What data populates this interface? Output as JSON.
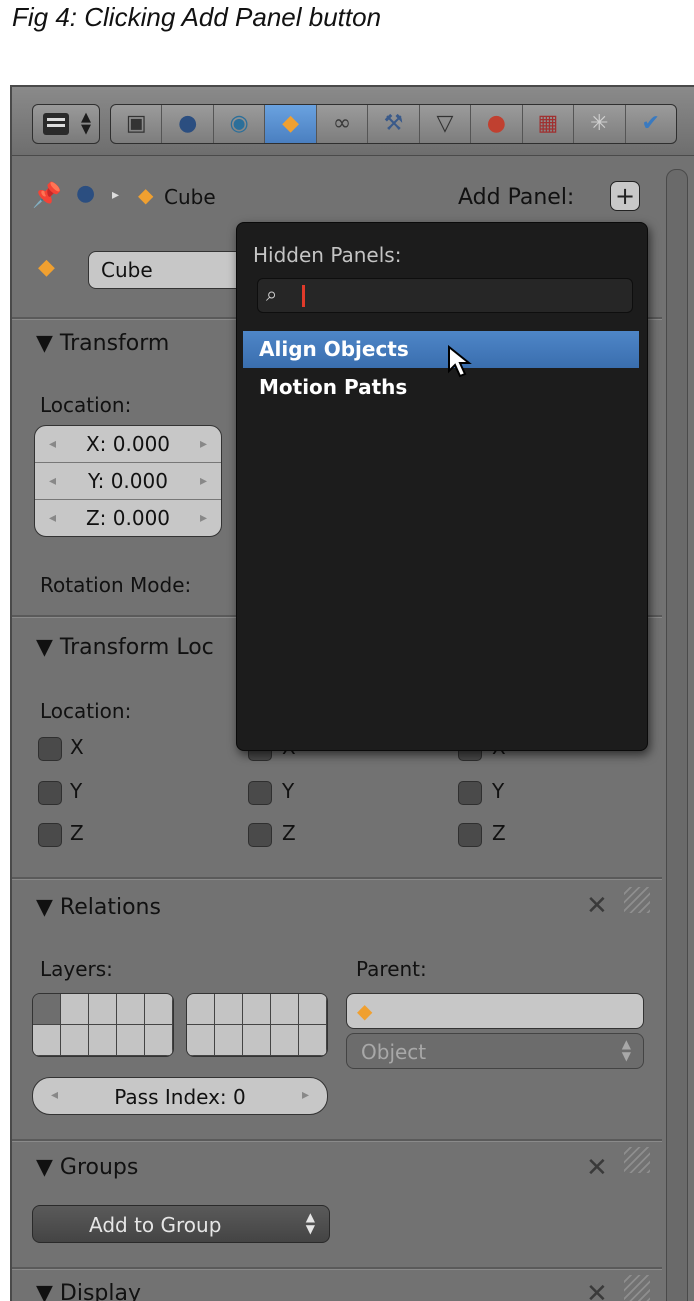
{
  "caption": "Fig 4: Clicking Add Panel button",
  "header": {
    "context_icons": [
      "camera-icon",
      "render-layers-icon",
      "world-icon",
      "object-icon",
      "constraints-icon",
      "wrench-icon",
      "mesh-data-icon",
      "material-icon",
      "texture-icon",
      "particles-icon",
      "physics-icon"
    ],
    "active_context": "object-icon"
  },
  "breadcrumb": {
    "object_name": "Cube",
    "add_panel_label": "Add Panel:"
  },
  "object_field": {
    "value": "Cube"
  },
  "transform": {
    "title": "Transform",
    "location_label": "Location:",
    "x": "X: 0.000",
    "y": "Y: 0.000",
    "z": "Z: 0.000",
    "rotation_mode_label": "Rotation Mode:"
  },
  "transform_locks": {
    "title": "Transform Loc",
    "location_label": "Location:",
    "axes": [
      "X",
      "Y",
      "Z"
    ]
  },
  "relations": {
    "title": "Relations",
    "layers_label": "Layers:",
    "parent_label": "Parent:",
    "parent_type": "Object",
    "pass_index": "Pass Index: 0"
  },
  "groups": {
    "title": "Groups",
    "add_to_group": "Add to Group"
  },
  "display": {
    "title": "Display"
  },
  "popup": {
    "title": "Hidden Panels:",
    "search_value": "",
    "items": [
      "Align Objects",
      "Motion Paths"
    ],
    "selected": "Align Objects"
  },
  "colors": {
    "selection": "#4a80c4",
    "text_cursor": "#e03a2a",
    "object_orange": "#f0a030"
  }
}
